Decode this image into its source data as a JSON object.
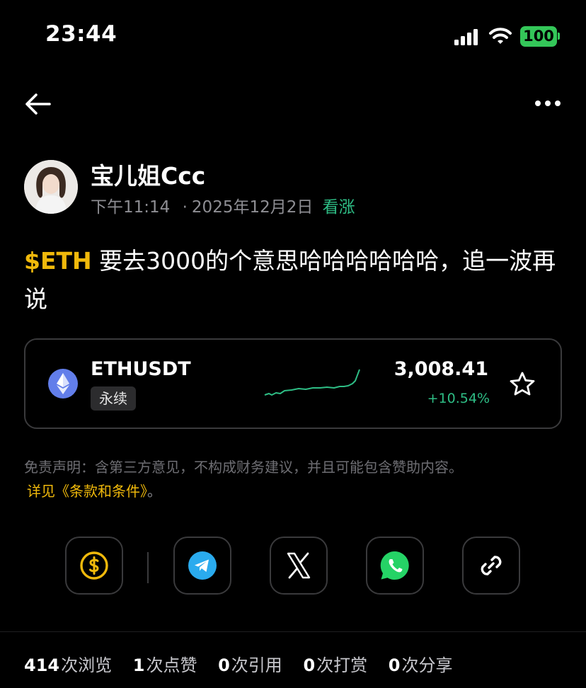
{
  "status_bar": {
    "time": "23:44",
    "battery": "100"
  },
  "post": {
    "author": "宝儿姐Ccc",
    "time": "下午11:14",
    "date_sep": "·",
    "date": "2025年12月2日",
    "sentiment": "看涨",
    "ticker": "$ETH",
    "text": " 要去3000的个意思哈哈哈哈哈哈，追一波再说"
  },
  "ticker_card": {
    "pair": "ETHUSDT",
    "tag": "永续",
    "price": "3,008.41",
    "change": "+10.54%"
  },
  "disclaimer": {
    "text": "免责声明：含第三方意见，不构成财务建议，并且可能包含赞助内容。",
    "link": "详见《条款和条件》",
    "period": "。"
  },
  "stats": [
    {
      "num": "414",
      "label": "次浏览"
    },
    {
      "num": "1",
      "label": "次点赞"
    },
    {
      "num": "0",
      "label": "次引用"
    },
    {
      "num": "0",
      "label": "次打赏"
    },
    {
      "num": "0",
      "label": "次分享"
    }
  ],
  "colors": {
    "accent": "#f0b90b",
    "positive": "#2ebd85",
    "battery": "#34c759"
  },
  "icons": [
    "back-arrow-icon",
    "more-icon",
    "ethereum-icon",
    "star-icon",
    "tip-icon",
    "telegram-icon",
    "x-icon",
    "whatsapp-icon",
    "link-icon"
  ]
}
